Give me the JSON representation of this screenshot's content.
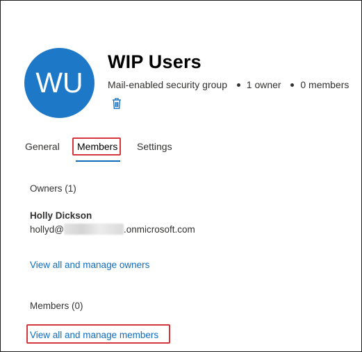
{
  "group": {
    "initials": "WU",
    "name": "WIP Users",
    "type": "Mail-enabled security group",
    "owner_count": "1 owner",
    "member_count": "0 members"
  },
  "tabs": [
    {
      "label": "General"
    },
    {
      "label": "Members"
    },
    {
      "label": "Settings"
    }
  ],
  "active_tab": "Members",
  "owners": {
    "heading": "Owners (1)",
    "items": [
      {
        "name": "Holly Dickson",
        "email_prefix": "hollyd@",
        "email_suffix": ".onmicrosoft.com"
      }
    ],
    "manage_link": "View all and manage owners"
  },
  "members": {
    "heading": "Members (0)",
    "manage_link": "View all and manage members"
  },
  "colors": {
    "avatar": "#1e78c8",
    "accent": "#0f6cbd",
    "highlight": "#d6343c"
  },
  "icons": {
    "delete": "trash-icon"
  }
}
